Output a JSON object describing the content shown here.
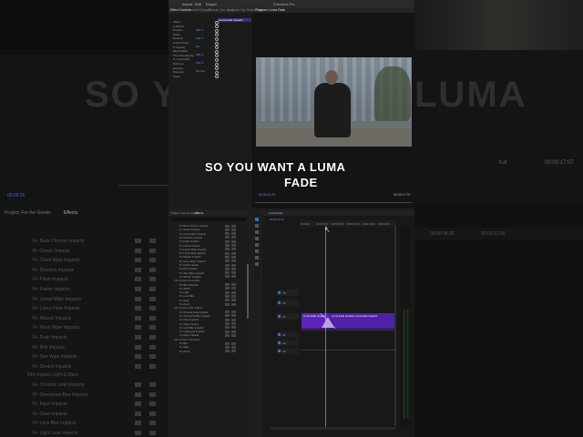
{
  "caption": {
    "line1": "SO YOU WANT A LUMA",
    "line2": "FADE"
  },
  "background": {
    "title": "SO YOU",
    "title_right": "LUMA",
    "timecode_right": "00:00:17:07",
    "zoom_right": "Full",
    "panel_tabs": {
      "project": "Project: For the Greats",
      "effects": "Effects"
    },
    "effects_list": [
      "Ft- Buck Chrome Impacts",
      "Ft- Check Impacts",
      "Ft- Clock Wipe Impacts",
      "Ft- Dissolve Impacts",
      "Ft- Flash Impacts",
      "Ft- Frame Impacts",
      "Ft- Linear Wipe Impacts",
      "Ft- Luma Fade Impacts",
      "Ft- Mosaic Impacts",
      "Ft- Neon Wipe Impacts",
      "Ft- Push Impacts",
      "Ft- Roll Impacts",
      "Ft- Star Wipe Impacts",
      "Ft- Stretch Impacts"
    ],
    "folder": "Film Impact Light & Blurs",
    "effects_list2": [
      "Ft- Chroma Leak Impacts",
      "Ft- Directional Blur Impacts",
      "Ft- Flare Impacts",
      "Ft- Glow Impacts",
      "Ft- Lens Blur Impacts",
      "Ft- Light Leak Impacts"
    ],
    "timeline_times": [
      "00:00:08:00",
      "00:00:12:00"
    ],
    "left_tc": "00:00:15"
  },
  "app": {
    "title": "Premiere Pro",
    "menu": [
      "Import",
      "Edit",
      "Export"
    ],
    "tabs": [
      "Effect Controls",
      "Lumetri Scopes",
      "Source: (no clips)",
      "Audio Clip Mixer: Seq",
      "Program: Luma Fade"
    ],
    "effect_controls": {
      "clip_name": "Luma Fade Impacts",
      "rows": [
        "Video",
        "fx Motion",
        "Position",
        "Scale",
        "Rotation",
        "Anchor Point",
        "fx Opacity",
        "Blend Mode",
        "Time Remapping",
        "fx Luma Fade",
        "Softness",
        "Reverse",
        "Direction",
        "Audio"
      ],
      "values": [
        "960.0",
        "100.0",
        "0.0",
        "960.0",
        "100 %",
        "Normal"
      ]
    },
    "program": {
      "timecode": "00:00:11:22",
      "fit": "Fit",
      "duration": "00:00:17:07"
    },
    "project": {
      "tabs": [
        "Project: For the Greats",
        "Effects"
      ]
    },
    "effects_panel": {
      "rows": [
        "Ft- Buck Chrome Impacts",
        "Ft- Check Impacts",
        "Ft- Clock Wipe Impacts",
        "Ft- Dissolve Impacts",
        "Ft- Flash Impacts",
        "Ft- Frame Impacts",
        "Ft- Linear Wipe Impacts",
        "Ft- Luma Fade Impacts",
        "Ft- Mosaic Impacts",
        "Ft- Neon Wipe Impacts",
        "Ft- Push Impacts",
        "Ft- Roll Impacts",
        "Ft- Star Wipe Impacts",
        "Ft- Stretch Impacts"
      ],
      "folder1": "Film Impact Essentials",
      "rows2": [
        "Ft- Blur Dissolve",
        "Ft- Glitch",
        "Ft- Light",
        "Ft- Lens Blur",
        "Ft- Rays",
        "Ft- Zoom"
      ],
      "folder2": "Film Impact Light & Blurs",
      "rows3": [
        "Ft- Chroma Leak Impacts",
        "Ft- Directional Blur Impacts",
        "Ft- Flare Impacts",
        "Ft- Glow Impacts",
        "Ft- Lens Blur Impacts",
        "Ft- Light Leak Impacts",
        "Ft- Rays Impacts"
      ],
      "folder3": "Film Impact Transitions",
      "rows4": [
        "Ft- Blur",
        "Ft- Wipe",
        "Ft- Zoom"
      ]
    },
    "timeline": {
      "tab": "Luma Fade",
      "timecode": "00:00:11:22",
      "ticks": [
        "00:00:00",
        "00:00:04:00",
        "00:00:08:00",
        "00:00:12:00",
        "00:00:16:00",
        "00:00:20:00"
      ],
      "clip1": "Luma Fade Impacts",
      "clip2": "Luma Fade Impacts   Luma Fade Impacts",
      "tracks": [
        "V3",
        "V2",
        "V1",
        "A1",
        "A2",
        "A3"
      ]
    }
  },
  "colors": {
    "accent": "#5c8fe6",
    "clip": "#5c24b8"
  }
}
